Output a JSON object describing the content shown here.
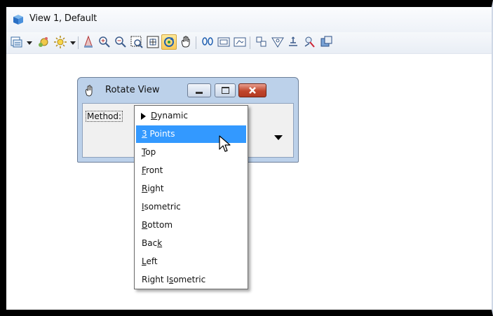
{
  "window": {
    "title": "View 1, Default",
    "icon": "view-cube-icon"
  },
  "toolbar": {
    "buttons": [
      "view-attributes-icon",
      "display-style-icon",
      "render-lights-icon",
      "update-view-icon",
      "zoom-in-icon",
      "zoom-out-icon",
      "window-area-icon",
      "fit-view-icon",
      "rotate-view-icon",
      "pan-view-icon",
      "view-previous-icon",
      "view-next-icon",
      "clip-volume-icon",
      "camera-icon",
      "change-view-perspective-icon",
      "view-tools-icon",
      "render-icon",
      "save-view-icon"
    ],
    "active_button": "rotate-view-icon"
  },
  "rotate_view_dialog": {
    "title": "Rotate View",
    "method_label": "Method:",
    "method_options": [
      {
        "label": "Dynamic",
        "mnemonic": "D",
        "checked": true
      },
      {
        "label": "3 Points",
        "mnemonic": "3",
        "selected": true
      },
      {
        "label": "Top",
        "mnemonic": "T"
      },
      {
        "label": "Front",
        "mnemonic": "F"
      },
      {
        "label": "Right",
        "mnemonic": "R"
      },
      {
        "label": "Isometric",
        "mnemonic": "I"
      },
      {
        "label": "Bottom",
        "mnemonic": "B"
      },
      {
        "label": "Back",
        "mnemonic": "k"
      },
      {
        "label": "Left",
        "mnemonic": "L"
      },
      {
        "label": "Right Isometric",
        "mnemonic": "s"
      }
    ]
  },
  "colors": {
    "selection": "#3399ff",
    "dialog_frame": "#bcd1ea",
    "close_button": "#c0452c",
    "active_tool": "#f8c95a"
  }
}
